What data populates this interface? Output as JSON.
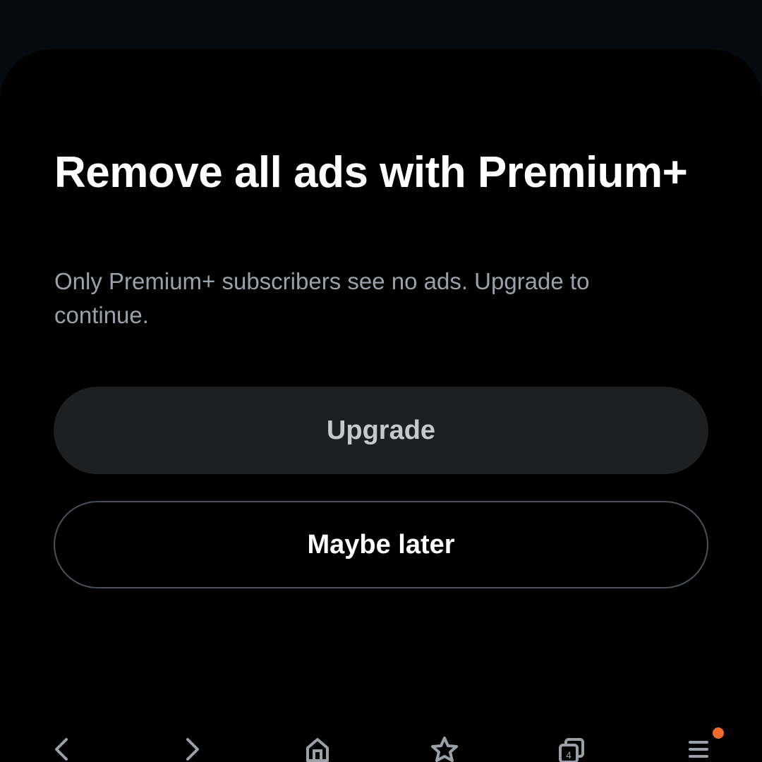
{
  "dialog": {
    "title": "Remove all ads with Premium+",
    "subtitle": "Only Premium+ subscribers see no ads. Upgrade to continue.",
    "upgrade_label": "Upgrade",
    "later_label": "Maybe later"
  },
  "nav": {
    "items": [
      {
        "icon": "back-arrow-icon"
      },
      {
        "icon": "forward-arrow-icon"
      },
      {
        "icon": "home-icon"
      },
      {
        "icon": "star-icon"
      },
      {
        "icon": "tabs-icon",
        "count": "4"
      },
      {
        "icon": "menu-icon",
        "has_notification": true
      }
    ]
  },
  "colors": {
    "background": "#000000",
    "title": "#ffffff",
    "subtitle": "#9ba1a8",
    "upgrade_bg": "#1d1f20",
    "upgrade_text": "#c5c9cd",
    "outline": "#4a5058",
    "nav_icon": "#9aa0a6",
    "notification_dot": "#f06a2a"
  }
}
